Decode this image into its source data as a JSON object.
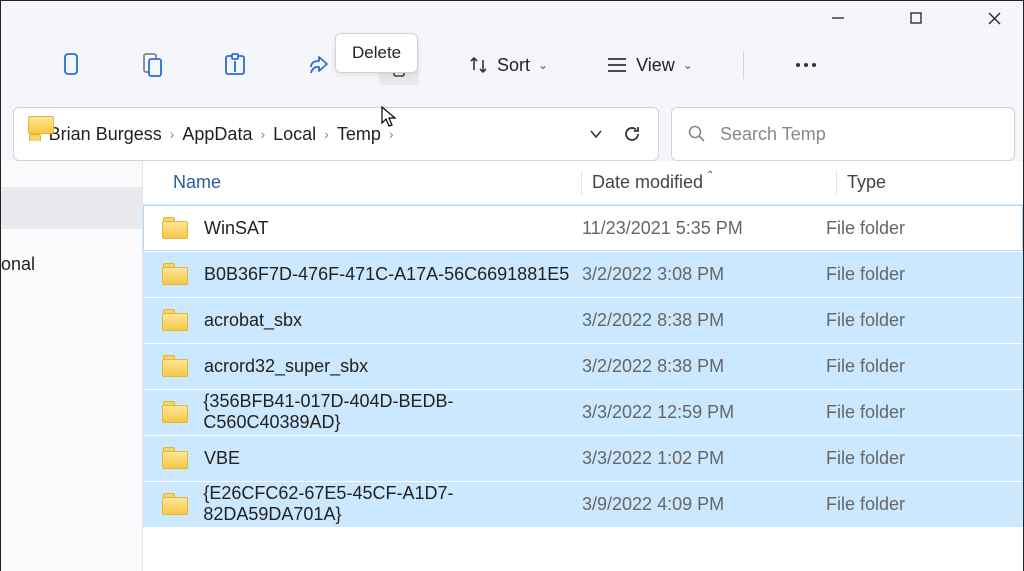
{
  "titlebar": {},
  "toolbar": {
    "tooltip": "Delete",
    "sort_label": "Sort",
    "view_label": "View"
  },
  "breadcrumb": {
    "items": [
      "Brian Burgess",
      "AppData",
      "Local",
      "Temp"
    ]
  },
  "search": {
    "placeholder": "Search Temp"
  },
  "sidebar": {
    "item_truncated": "onal"
  },
  "columns": {
    "name": "Name",
    "date": "Date modified",
    "type": "Type"
  },
  "rows": [
    {
      "name": "WinSAT",
      "date": "11/23/2021 5:35 PM",
      "type": "File folder",
      "selected": false
    },
    {
      "name": "B0B36F7D-476F-471C-A17A-56C6691881E5",
      "date": "3/2/2022 3:08 PM",
      "type": "File folder",
      "selected": true
    },
    {
      "name": "acrobat_sbx",
      "date": "3/2/2022 8:38 PM",
      "type": "File folder",
      "selected": true
    },
    {
      "name": "acrord32_super_sbx",
      "date": "3/2/2022 8:38 PM",
      "type": "File folder",
      "selected": true
    },
    {
      "name": "{356BFB41-017D-404D-BEDB-C560C40389AD}",
      "date": "3/3/2022 12:59 PM",
      "type": "File folder",
      "selected": true
    },
    {
      "name": "VBE",
      "date": "3/3/2022 1:02 PM",
      "type": "File folder",
      "selected": true
    },
    {
      "name": "{E26CFC62-67E5-45CF-A1D7-82DA59DA701A}",
      "date": "3/9/2022 4:09 PM",
      "type": "File folder",
      "selected": true
    }
  ]
}
